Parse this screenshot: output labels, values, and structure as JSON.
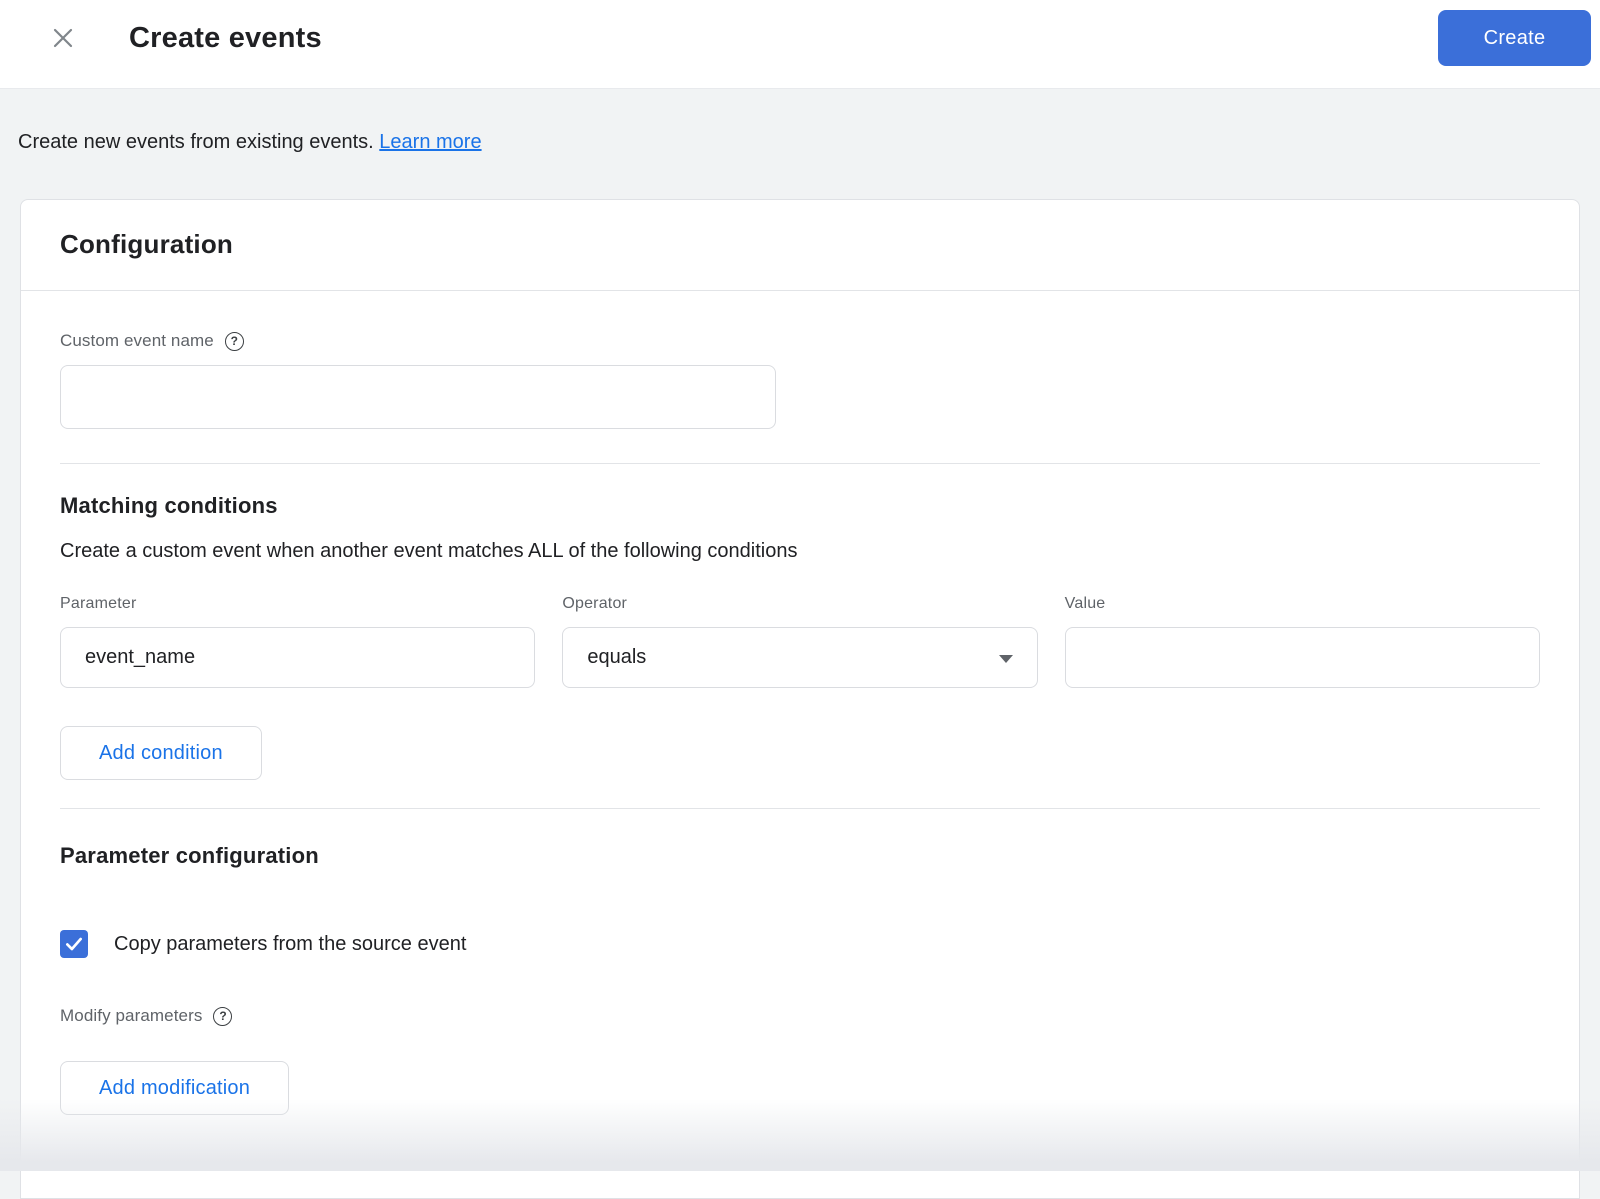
{
  "header": {
    "title": "Create events",
    "create_button": "Create"
  },
  "intro": {
    "text": "Create new events from existing events.",
    "link": "Learn more"
  },
  "card": {
    "title": "Configuration",
    "custom_event_name": {
      "label": "Custom event name",
      "value": "",
      "placeholder": ""
    },
    "matching": {
      "title": "Matching conditions",
      "description": "Create a custom event when another event matches ALL of the following conditions",
      "labels": {
        "parameter": "Parameter",
        "operator": "Operator",
        "value": "Value"
      },
      "conditions": [
        {
          "parameter": "event_name",
          "operator": "equals",
          "value": ""
        }
      ],
      "add_condition_label": "Add condition"
    },
    "parameter_config": {
      "title": "Parameter configuration",
      "copy_checkbox": {
        "checked": true,
        "label": "Copy parameters from the source event"
      },
      "modify_label": "Modify parameters",
      "add_modification_label": "Add modification"
    }
  },
  "icons": {
    "close": "close-icon",
    "help": "?",
    "caret": "chevron-down-icon",
    "checkmark": "checkmark-icon"
  },
  "colors": {
    "accent_blue": "#3b6fd9",
    "link_blue": "#1a73e8",
    "page_background": "#f1f3f4",
    "text_primary": "#202124",
    "text_secondary": "#5f6368",
    "field_border": "#dadce0"
  }
}
